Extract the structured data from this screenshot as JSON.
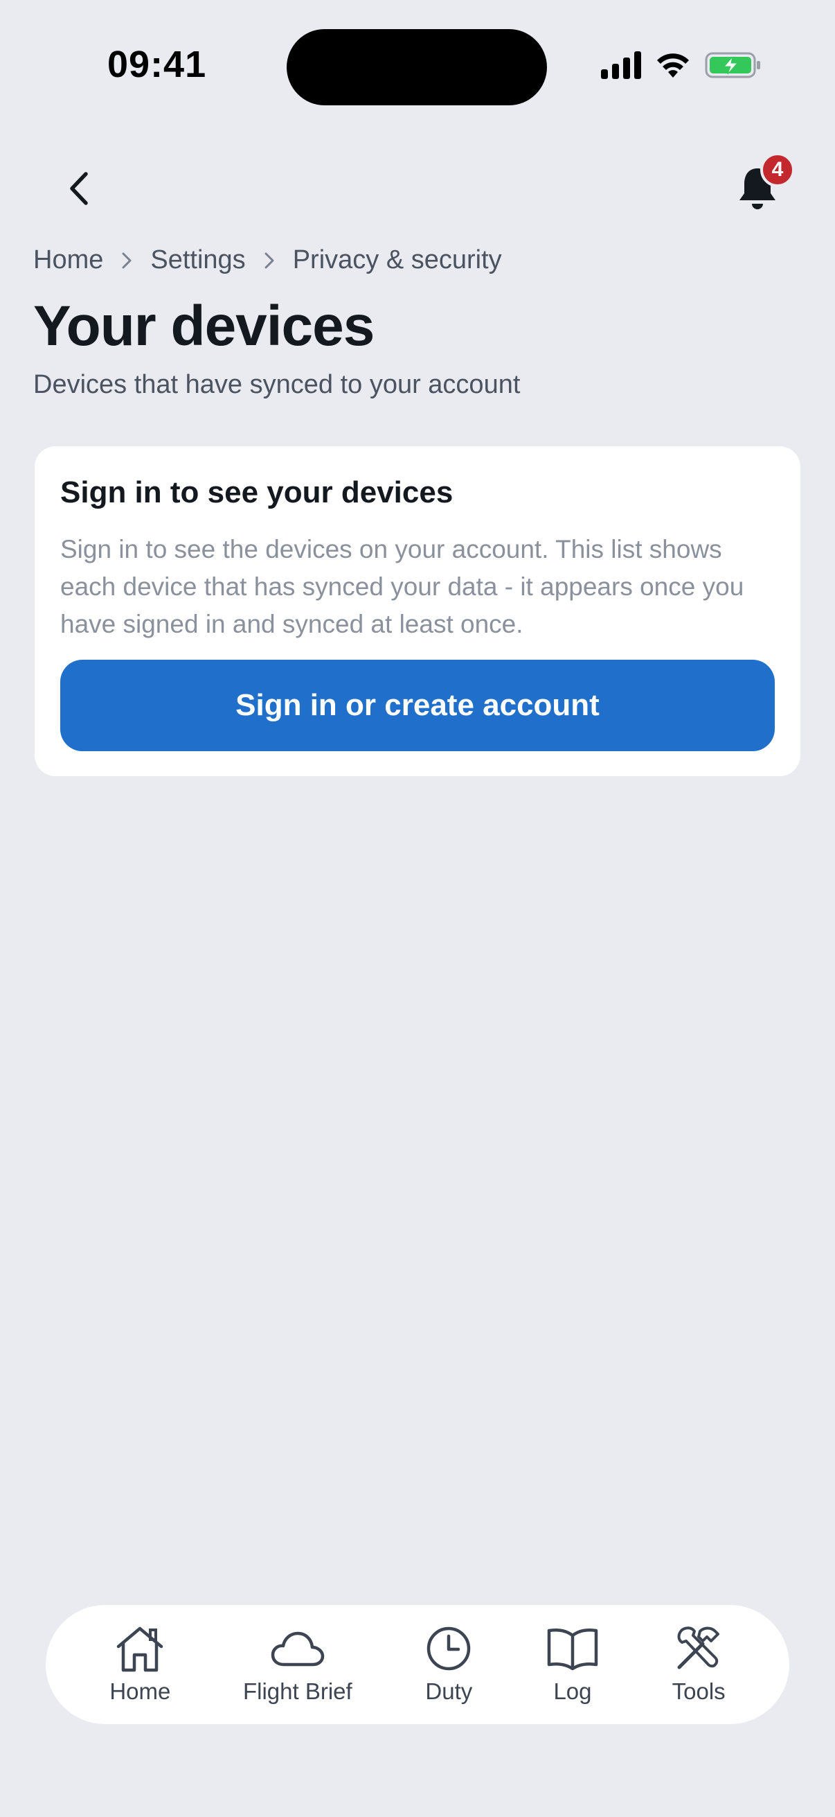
{
  "status_bar": {
    "time": "09:41"
  },
  "header": {
    "back_icon": "chevron-left-icon",
    "notifications_icon": "bell-icon",
    "notification_count": "4"
  },
  "breadcrumb": {
    "items": [
      "Home",
      "Settings",
      "Privacy & security"
    ]
  },
  "page": {
    "title": "Your devices",
    "subtitle": "Devices that have synced to your account"
  },
  "card": {
    "title": "Sign in to see your devices",
    "body": "Sign in to see the devices on your account. This list shows each device that has synced your data - it appears once you have signed in and synced at least once.",
    "button_label": "Sign in or create account"
  },
  "bottom_nav": {
    "items": [
      {
        "label": "Home",
        "icon": "home-icon"
      },
      {
        "label": "Flight Brief",
        "icon": "cloud-icon"
      },
      {
        "label": "Duty",
        "icon": "clock-icon"
      },
      {
        "label": "Log",
        "icon": "book-icon"
      },
      {
        "label": "Tools",
        "icon": "tools-icon"
      }
    ]
  },
  "colors": {
    "background": "#e9ebf0",
    "primary": "#1f6fcb",
    "badge": "#c3282e",
    "battery": "#34c759"
  }
}
